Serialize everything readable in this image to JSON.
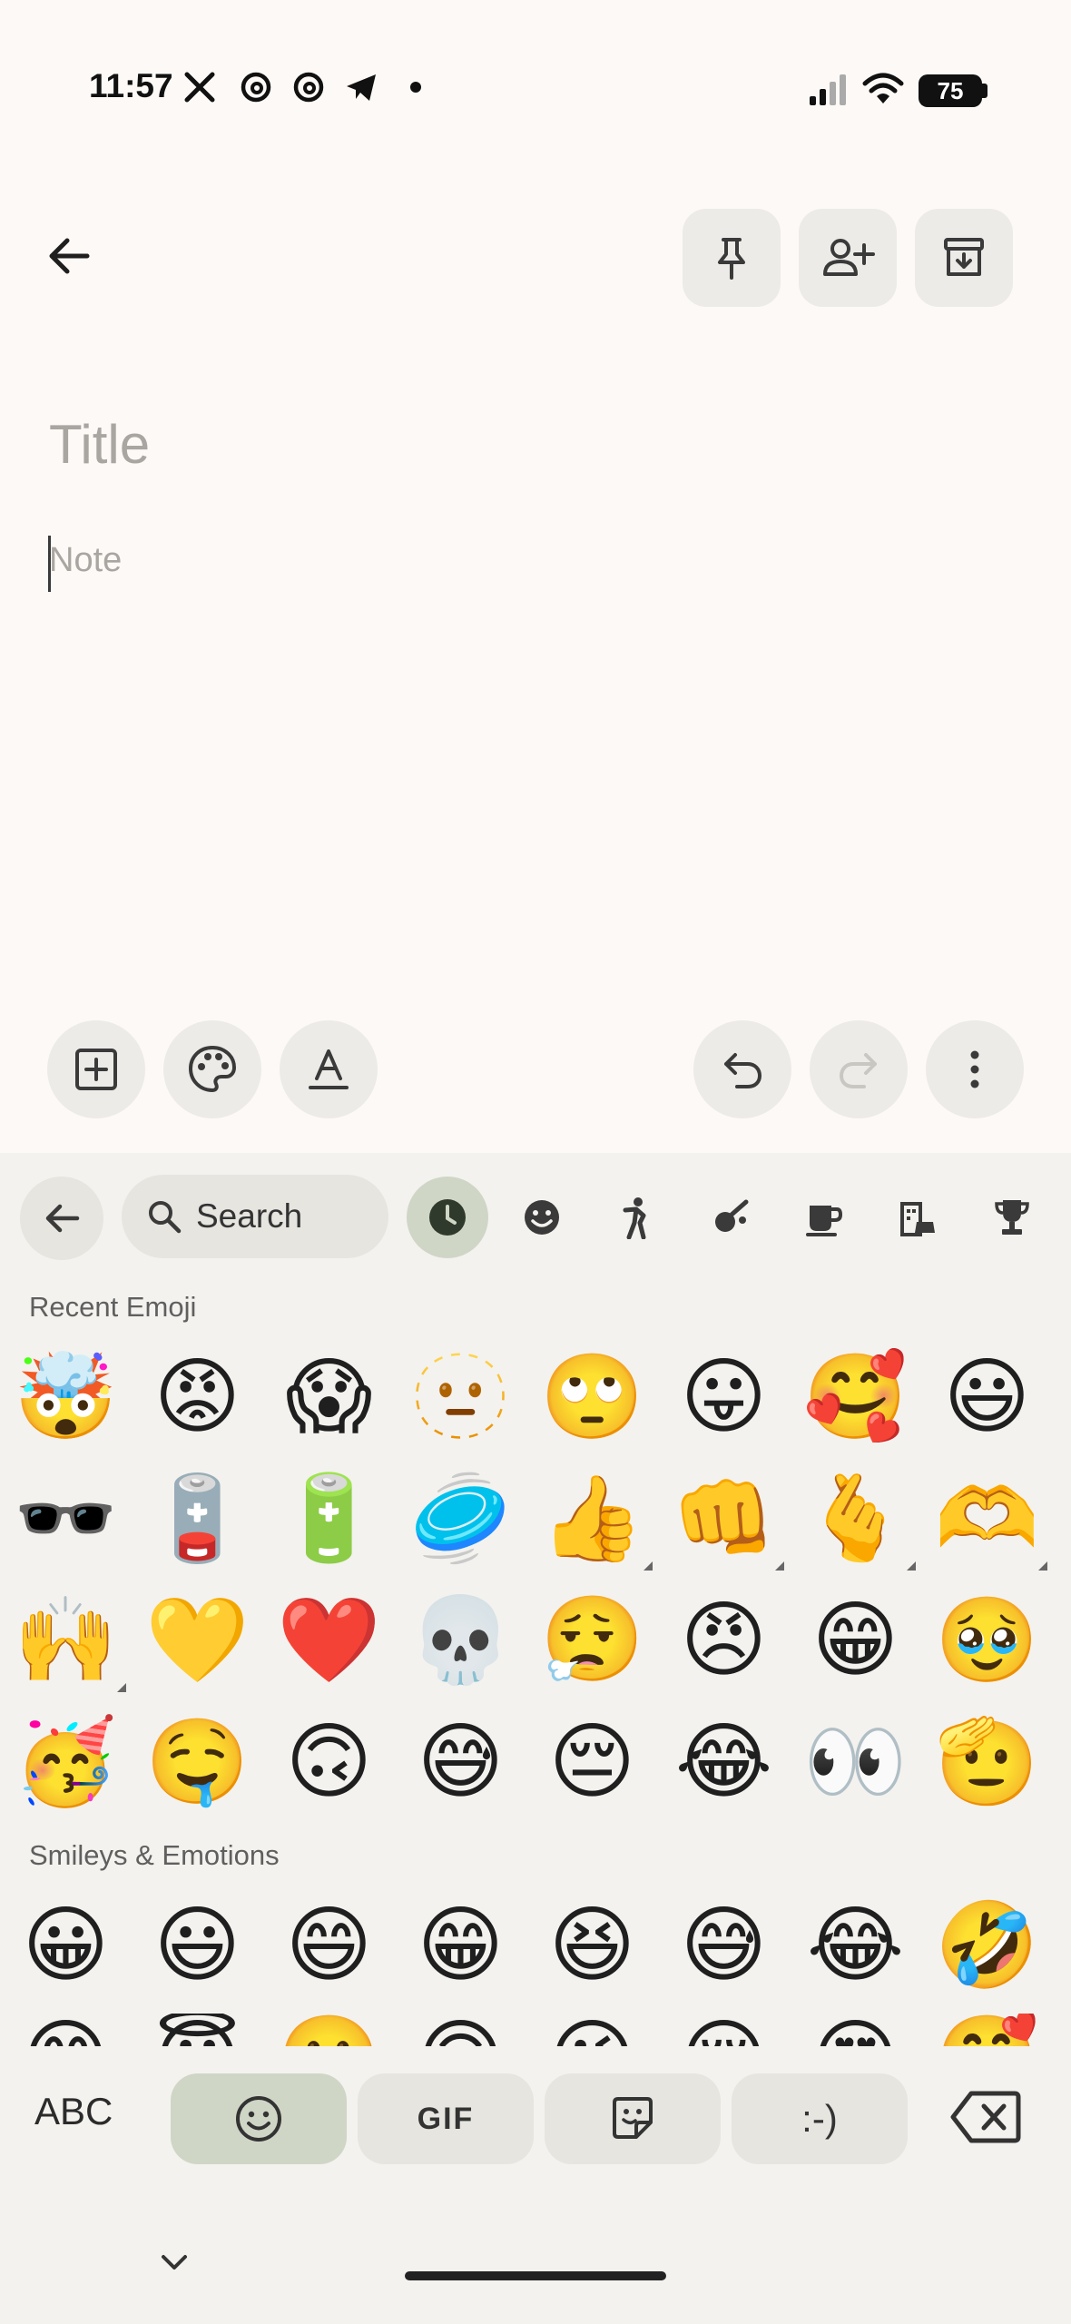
{
  "status_bar": {
    "time": "11:57",
    "notification_icons": [
      "x-icon",
      "threads-icon",
      "threads-icon",
      "telegram-icon",
      "dot-icon"
    ],
    "battery_level": "75"
  },
  "top_bar": {
    "back_icon": "arrow-back-icon",
    "actions": [
      "pin-icon",
      "add-collaborator-icon",
      "archive-icon"
    ]
  },
  "note": {
    "title_placeholder": "Title",
    "body_placeholder": "Note"
  },
  "bottom_toolbar": {
    "left": [
      "add-box-icon",
      "palette-icon",
      "text-format-icon"
    ],
    "right": [
      "undo-icon",
      "redo-icon",
      "more-vert-icon"
    ],
    "redo_enabled": false
  },
  "keyboard": {
    "search_label": "Search",
    "category_tabs": [
      "recent-icon",
      "smileys-icon",
      "people-icon",
      "activities-icon",
      "food-icon",
      "travel-icon",
      "objects-icon"
    ],
    "active_tab": "recent-icon",
    "recent_title": "Recent Emoji",
    "recent": [
      "🤯",
      "😡",
      "😱",
      "🫥",
      "🙄",
      "😛",
      "🥰",
      "😃",
      "🕶️",
      "🪫",
      "🔋",
      "🥏",
      "👍",
      "👊",
      "🫰",
      "🫶",
      "🙌",
      "💛",
      "❤️",
      "💀",
      "😮‍💨",
      "😠",
      "😁",
      "🥹",
      "🥳",
      "🤤",
      "🙃",
      "😅",
      "😔",
      "😂",
      "👀",
      "🫡"
    ],
    "smileys_title": "Smileys & Emotions",
    "smileys": [
      "😀",
      "😃",
      "😄",
      "😁",
      "😆",
      "😅",
      "😂",
      "🤣"
    ],
    "smileys_next": [
      "😊",
      "😇",
      "🙂",
      "🙃",
      "😉",
      "😌",
      "😍",
      "🥰"
    ],
    "mode_abc": "ABC",
    "mode_gif": "GIF",
    "mode_emoticon": ":-)",
    "active_mode": "emoji"
  }
}
